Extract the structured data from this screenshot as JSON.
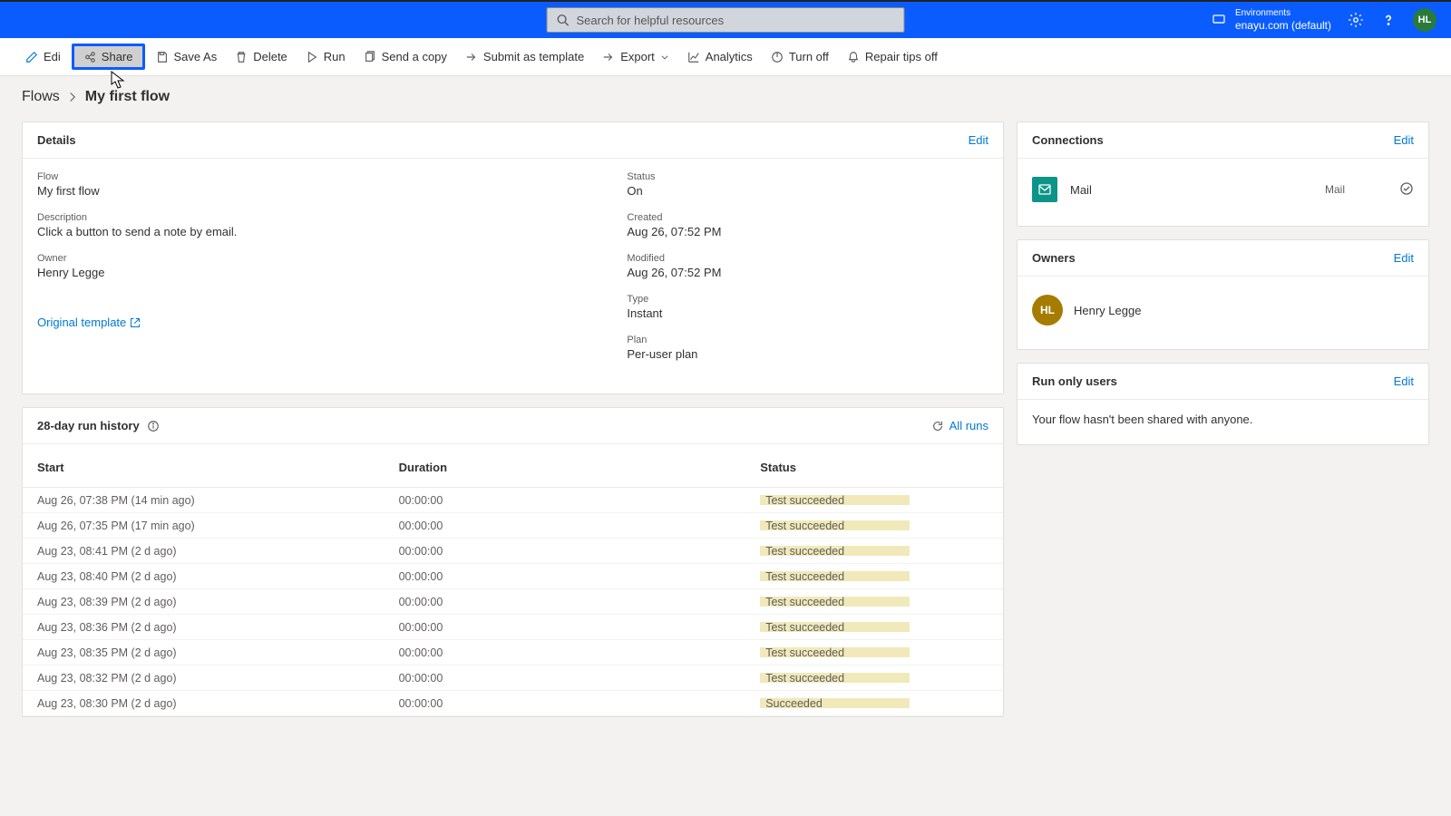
{
  "search": {
    "placeholder": "Search for helpful resources"
  },
  "environments": {
    "label": "Environments",
    "name": "enayu.com (default)"
  },
  "avatar_initials": "HL",
  "commands": {
    "edit": "Edi",
    "share": "Share",
    "save_as": "Save As",
    "delete": "Delete",
    "run": "Run",
    "send_copy": "Send a copy",
    "submit_template": "Submit as template",
    "export": "Export",
    "analytics": "Analytics",
    "turn_off": "Turn off",
    "repair_off": "Repair tips off"
  },
  "breadcrumb": {
    "root": "Flows",
    "current": "My first flow"
  },
  "details": {
    "title": "Details",
    "edit": "Edit",
    "flow_label": "Flow",
    "flow_value": "My first flow",
    "desc_label": "Description",
    "desc_value": "Click a button to send a note by email.",
    "owner_label": "Owner",
    "owner_value": "Henry Legge",
    "status_label": "Status",
    "status_value": "On",
    "created_label": "Created",
    "created_value": "Aug 26, 07:52 PM",
    "modified_label": "Modified",
    "modified_value": "Aug 26, 07:52 PM",
    "type_label": "Type",
    "type_value": "Instant",
    "plan_label": "Plan",
    "plan_value": "Per-user plan",
    "template_link": "Original template"
  },
  "connections": {
    "title": "Connections",
    "edit": "Edit",
    "items": [
      {
        "name": "Mail",
        "type": "Mail"
      }
    ]
  },
  "owners": {
    "title": "Owners",
    "edit": "Edit",
    "initials": "HL",
    "name": "Henry Legge"
  },
  "run_only": {
    "title": "Run only users",
    "edit": "Edit",
    "empty": "Your flow hasn't been shared with anyone."
  },
  "history": {
    "title": "28-day run history",
    "all_runs": "All runs",
    "col_start": "Start",
    "col_duration": "Duration",
    "col_status": "Status",
    "rows": [
      {
        "start": "Aug 26, 07:38 PM (14 min ago)",
        "duration": "00:00:00",
        "status": "Test succeeded"
      },
      {
        "start": "Aug 26, 07:35 PM (17 min ago)",
        "duration": "00:00:00",
        "status": "Test succeeded"
      },
      {
        "start": "Aug 23, 08:41 PM (2 d ago)",
        "duration": "00:00:00",
        "status": "Test succeeded"
      },
      {
        "start": "Aug 23, 08:40 PM (2 d ago)",
        "duration": "00:00:00",
        "status": "Test succeeded"
      },
      {
        "start": "Aug 23, 08:39 PM (2 d ago)",
        "duration": "00:00:00",
        "status": "Test succeeded"
      },
      {
        "start": "Aug 23, 08:36 PM (2 d ago)",
        "duration": "00:00:00",
        "status": "Test succeeded"
      },
      {
        "start": "Aug 23, 08:35 PM (2 d ago)",
        "duration": "00:00:00",
        "status": "Test succeeded"
      },
      {
        "start": "Aug 23, 08:32 PM (2 d ago)",
        "duration": "00:00:00",
        "status": "Test succeeded"
      },
      {
        "start": "Aug 23, 08:30 PM (2 d ago)",
        "duration": "00:00:00",
        "status": "Succeeded"
      }
    ]
  }
}
